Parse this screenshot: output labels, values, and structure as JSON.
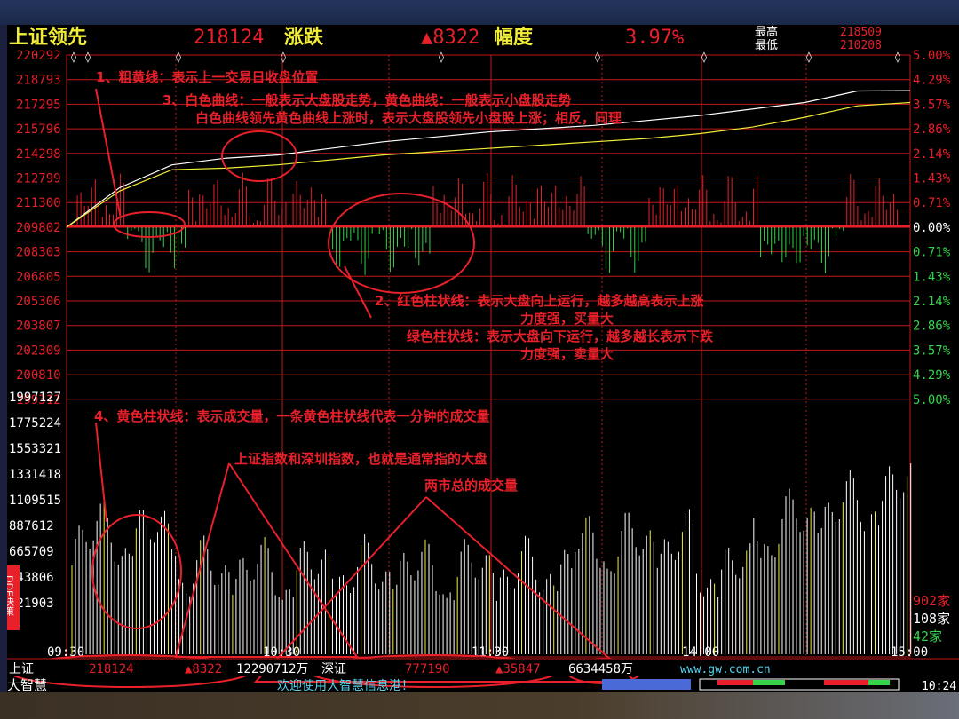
{
  "header": {
    "title": "上证领先",
    "index_value": "218124",
    "change_label": "涨跌",
    "change_value": "▲8322",
    "range_label": "幅度",
    "range_value": "3.97%",
    "high_label": "最高",
    "low_label": "最低",
    "high_value": "218509",
    "low_value": "210208"
  },
  "colors": {
    "red": "#e8202a",
    "yellow": "#f2ee38",
    "white": "#ffffff",
    "green": "#35d24a",
    "grid": "#c01818",
    "cyan": "#55d6f0"
  },
  "chart_data": [
    {
      "type": "line",
      "y_ticks": [
        "220292",
        "218793",
        "217295",
        "215796",
        "214298",
        "212799",
        "211300",
        "209802",
        "208303",
        "206805",
        "205306",
        "203807",
        "202309",
        "200810",
        "199312"
      ],
      "y2_ticks": [
        "5.00%",
        "4.29%",
        "3.57%",
        "2.86%",
        "2.14%",
        "1.43%",
        "0.71%",
        "0.00%",
        "0.71%",
        "1.43%",
        "2.14%",
        "2.86%",
        "3.57%",
        "4.29%",
        "5.00%"
      ],
      "series": [
        {
          "x": [
            0,
            15,
            30,
            45,
            60,
            75,
            90,
            105,
            120,
            135,
            150,
            165,
            180,
            195,
            210,
            225,
            240
          ],
          "y": [
            209802,
            212200,
            213600,
            214000,
            214200,
            214600,
            215000,
            215300,
            215600,
            215800,
            216000,
            216300,
            216600,
            217000,
            217400,
            218100,
            218124
          ]
        },
        {
          "x": [
            0,
            15,
            30,
            45,
            60,
            75,
            90,
            105,
            120,
            135,
            150,
            165,
            180,
            195,
            210,
            225,
            240
          ],
          "y": [
            209802,
            212000,
            213300,
            213400,
            213600,
            213900,
            214200,
            214400,
            214600,
            214800,
            215000,
            215200,
            215500,
            215900,
            216500,
            217200,
            217400
          ]
        }
      ]
    },
    {
      "type": "bar",
      "y_ticks": [
        "1997127",
        "1775224",
        "1553321",
        "1331418",
        "1109515",
        "887612",
        "665709",
        "443806",
        "221903"
      ],
      "x_ticks": [
        "09:30",
        "10:30",
        "11:30",
        "14:00",
        "15:00"
      ]
    }
  ],
  "annotations": [
    "1、粗黄线：表示上一交易日收盘位置",
    "3、白色曲线：一般表示大盘股走势，黄色曲线：一般表示小盘股走势",
    "白色曲线领先黄色曲线上涨时，表示大盘股领先小盘股上涨；相反，同理",
    "2、红色柱状线：表示大盘向上运行，越多越高表示上涨",
    "力度强，买量大",
    "绿色柱状线：表示大盘向下运行，越多越长表示下跌",
    "力度强，卖量大",
    "4、黄色柱状线：表示成交量，一条黄色柱状线代表一分钟的成交量",
    "上证指数和深圳指数，也就是通常指的大盘",
    "两市总的成交量"
  ],
  "breadth": [
    "902家",
    "108家",
    "42家"
  ],
  "side_tab": "DDE决策",
  "status": {
    "sh_label": "上证",
    "sh_value": "218124",
    "sh_change": "▲8322",
    "sh_volume": "12290712万",
    "sz_label": "深证",
    "sz_value": "777190",
    "sz_change": "▲35847",
    "sz_volume": "6634458万",
    "url": "www.gw.com.cn",
    "app_name": "大智慧",
    "welcome": "欢迎使用大智慧信息港！",
    "time": "10:24"
  }
}
